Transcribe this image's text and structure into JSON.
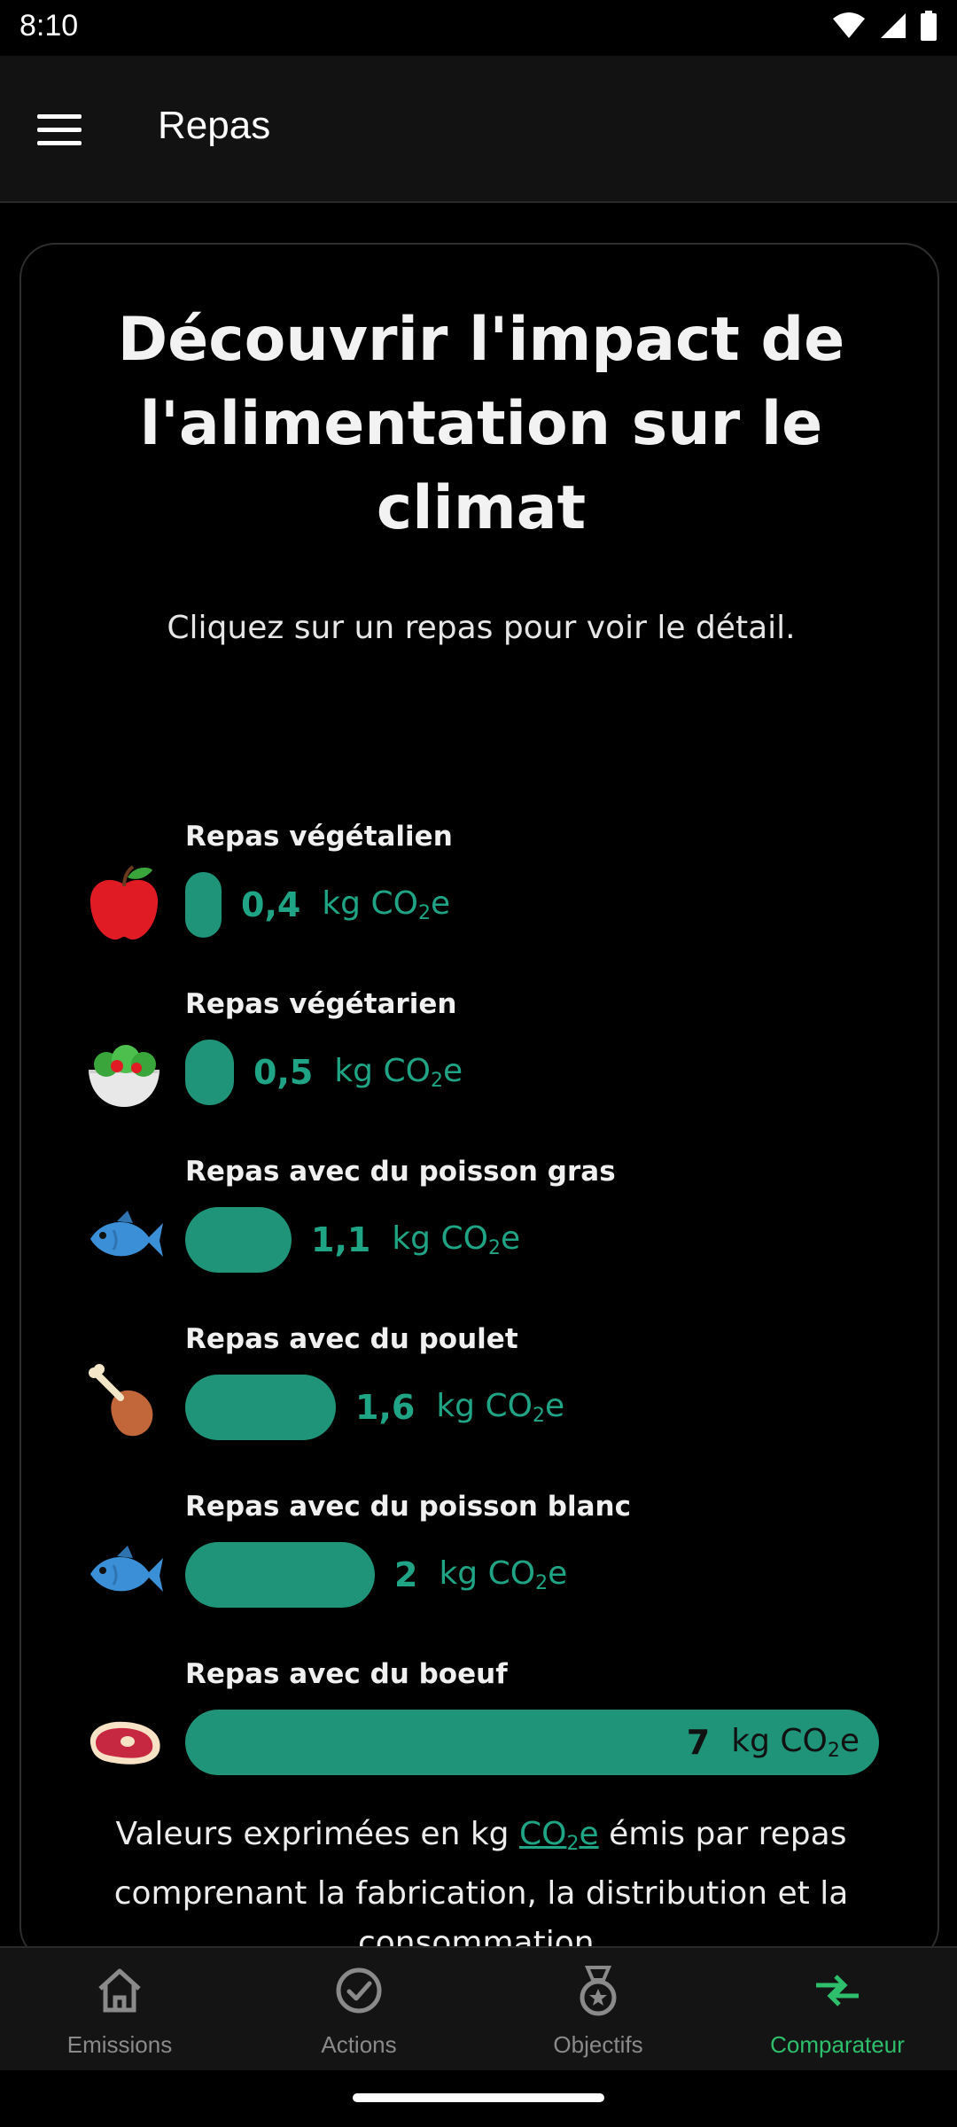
{
  "status": {
    "time": "8:10"
  },
  "appbar": {
    "title": "Repas"
  },
  "card": {
    "title": "Découvrir l'impact de l'alimentation sur le climat",
    "subtitle": "Cliquez sur un repas pour voir le détail.",
    "unit_prefix": "kg CO",
    "unit_sub": "2",
    "unit_suffix": "e",
    "max_value": 7,
    "meals": [
      {
        "label": "Repas végétalien",
        "value": "0,4",
        "amount": 0.4,
        "icon": "apple-icon"
      },
      {
        "label": "Repas végétarien",
        "value": "0,5",
        "amount": 0.5,
        "icon": "salad-icon"
      },
      {
        "label": "Repas avec du poisson gras",
        "value": "1,1",
        "amount": 1.1,
        "icon": "fish-icon"
      },
      {
        "label": "Repas avec du poulet",
        "value": "1,6",
        "amount": 1.6,
        "icon": "poultry-leg-icon"
      },
      {
        "label": "Repas avec du poisson blanc",
        "value": "2",
        "amount": 2,
        "icon": "fish-icon"
      },
      {
        "label": "Repas avec du boeuf",
        "value": "7",
        "amount": 7,
        "icon": "steak-icon"
      }
    ],
    "footnote": {
      "before": "Valeurs exprimées en kg ",
      "link_main": "CO",
      "link_sub": "2",
      "link_end": "e",
      "after": " émis par repas comprenant la fabrication, la distribution et la consommation."
    }
  },
  "nav": {
    "items": [
      {
        "label": "Emissions",
        "icon": "home-icon",
        "active": false
      },
      {
        "label": "Actions",
        "icon": "check-circle-icon",
        "active": false
      },
      {
        "label": "Objectifs",
        "icon": "medal-icon",
        "active": false
      },
      {
        "label": "Comparateur",
        "icon": "compare-arrows-icon",
        "active": true
      }
    ]
  },
  "colors": {
    "accent": "#1f9479",
    "value_text": "#1fa585",
    "nav_active": "#2dbf6b"
  }
}
